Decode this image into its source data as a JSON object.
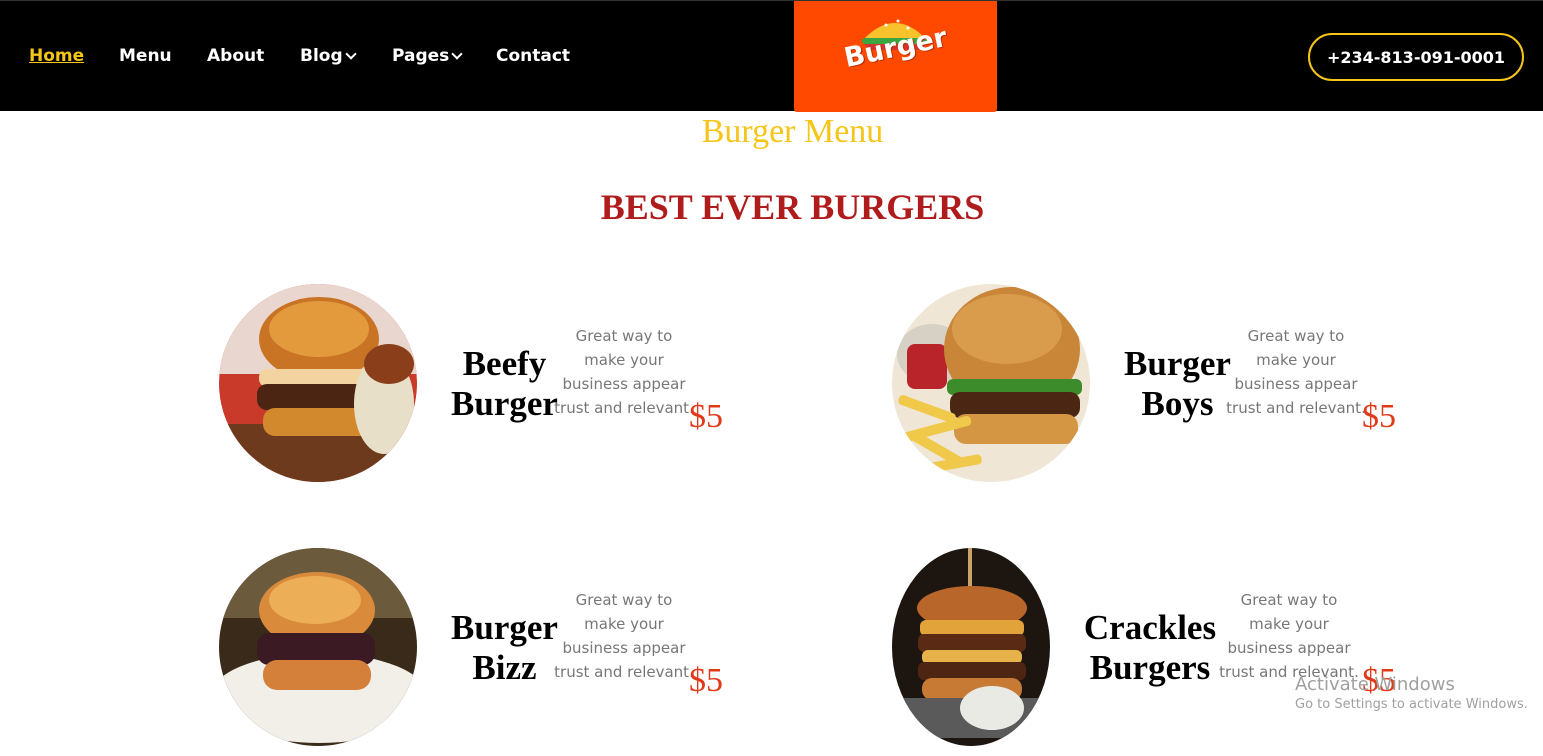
{
  "nav": {
    "items": [
      {
        "label": "Home"
      },
      {
        "label": "Menu"
      },
      {
        "label": "About"
      },
      {
        "label": "Blog"
      },
      {
        "label": "Pages"
      },
      {
        "label": "Contact"
      }
    ]
  },
  "logo": {
    "text": "Burger"
  },
  "phone": "+234-813-091-0001",
  "section": {
    "subtitle": "Burger Menu",
    "title": "BEST EVER BURGERS"
  },
  "menu_items": [
    {
      "name_line1": "Beefy",
      "name_line2": "Burger",
      "description": "Great way to make your business appear trust and relevant.",
      "price": "$5"
    },
    {
      "name_line1": "Burger",
      "name_line2": "Boys",
      "description": "Great way to make your business appear trust and relevant.",
      "price": "$5"
    },
    {
      "name_line1": "Burger",
      "name_line2": "Bizz",
      "description": "Great way to make your business appear trust and relevant.",
      "price": "$5"
    },
    {
      "name_line1": "Crackles",
      "name_line2": "Burgers",
      "description": "Great way to make your business appear trust and relevant.",
      "price": "$5"
    }
  ],
  "watermark": {
    "line1": "Activate Windows",
    "line2": "Go to Settings to activate Windows."
  }
}
